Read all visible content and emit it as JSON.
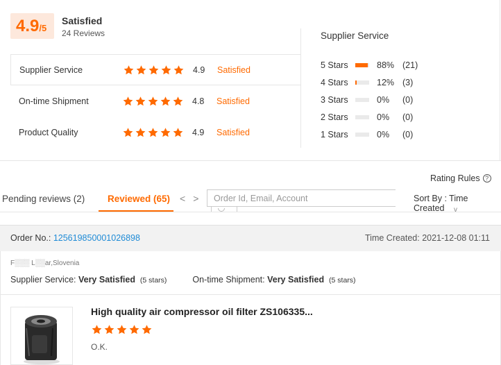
{
  "overall": {
    "score": "4.9",
    "score_suffix": "/5",
    "label": "Satisfied",
    "reviews": "24 Reviews"
  },
  "metrics": [
    {
      "name": "Supplier Service",
      "stars": 5,
      "score": "4.9",
      "status": "Satisfied"
    },
    {
      "name": "On-time Shipment",
      "stars": 5,
      "score": "4.8",
      "status": "Satisfied"
    },
    {
      "name": "Product Quality",
      "stars": 5,
      "score": "4.9",
      "status": "Satisfied"
    }
  ],
  "distribution": {
    "title": "Supplier Service",
    "rows": [
      {
        "label": "5 Stars",
        "fraction": 0.88,
        "pct": "88%",
        "count": "(21)"
      },
      {
        "label": "4 Stars",
        "fraction": 0.12,
        "pct": "12%",
        "count": "(3)"
      },
      {
        "label": "3 Stars",
        "fraction": 0,
        "pct": "0%",
        "count": "(0)"
      },
      {
        "label": "2 Stars",
        "fraction": 0,
        "pct": "0%",
        "count": "(0)"
      },
      {
        "label": "1 Stars",
        "fraction": 0,
        "pct": "0%",
        "count": "(0)"
      }
    ]
  },
  "toolbar": {
    "rating_rules": "Rating Rules",
    "help_glyph": "?",
    "tab_pending": "Pending reviews (2)",
    "tab_reviewed": "Reviewed (65)",
    "prev_glyph": "<",
    "next_glyph": ">",
    "search_placeholder": "Order Id, Email, Account",
    "sort_by": "Sort By : Time Created",
    "sort_caret": "v"
  },
  "order": {
    "order_no_label": "Order No.: ",
    "order_no": "125619850001026898",
    "time_created": "Time Created: 2021-12-08 01:11",
    "buyer": "F░░░ L░░ar,Slovenia",
    "supplier_service_label": "Supplier Service: ",
    "supplier_service_value": "Very Satisfied",
    "supplier_service_stars": "(5 stars)",
    "shipment_label": "On-time Shipment: ",
    "shipment_value": "Very Satisfied",
    "shipment_stars": "(5 stars)"
  },
  "product": {
    "title": "High quality air compressor oil filter ZS106335...",
    "stars": 5,
    "comment": "O.K."
  },
  "colors": {
    "accent": "#ff6a00",
    "link": "#1f8bd6",
    "score_bg": "#fde8dc"
  },
  "icons": {
    "star": "star-icon",
    "help": "help-circle-icon",
    "prev": "chevron-left-icon",
    "next": "chevron-right-icon",
    "search": "search-icon",
    "sort": "chevron-down-icon",
    "product": "oil-filter-product-image"
  }
}
